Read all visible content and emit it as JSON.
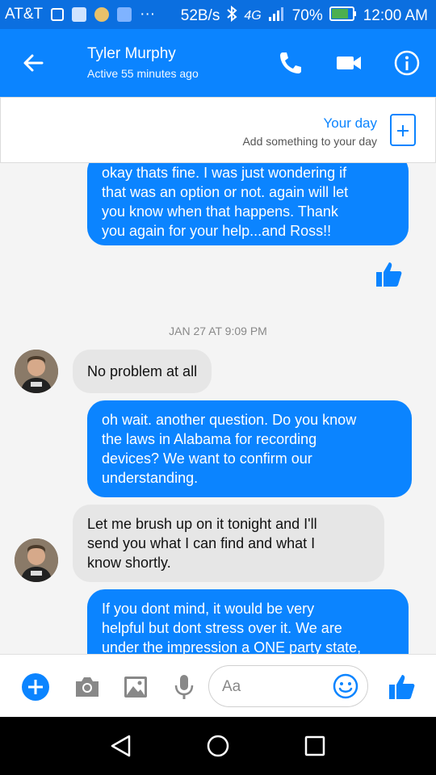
{
  "status_bar": {
    "carrier": "AT&T",
    "more": "···",
    "speed": "52B/s",
    "network": "4G",
    "battery": "70%",
    "time": "12:00 AM"
  },
  "header": {
    "contact_name": "Tyler Murphy",
    "contact_status": "Active 55 minutes ago"
  },
  "your_day": {
    "title": "Your day",
    "subtitle": "Add something to your day"
  },
  "messages": [
    {
      "from": "me",
      "lines": [
        "okay thats fine. I was just wondering if",
        "that was an option or not. again will let",
        "you know when that happens. Thank",
        "you again for your help...and Ross!!"
      ]
    },
    {
      "from": "them",
      "lines": [
        "No problem at all"
      ]
    },
    {
      "from": "me",
      "lines": [
        "oh wait. another question. Do you know",
        "the laws in Alabama for recording",
        "devices? We want to confirm our",
        "understanding."
      ]
    },
    {
      "from": "them",
      "lines": [
        "Let me brush up on it tonight and I'll",
        "send you what I can find and what I",
        "know shortly."
      ]
    },
    {
      "from": "me",
      "lines": [
        "If you dont mind, it would be very",
        "helpful but dont stress over it. We are",
        "under the impression a ONE party state,"
      ]
    }
  ],
  "timestamp": "JAN 27 AT 9:09 PM",
  "composer": {
    "placeholder": "Aa"
  },
  "colors": {
    "brand": "#0b84ff",
    "status_bar": "#0b6fe0",
    "incoming_bubble": "#e6e6e6"
  }
}
